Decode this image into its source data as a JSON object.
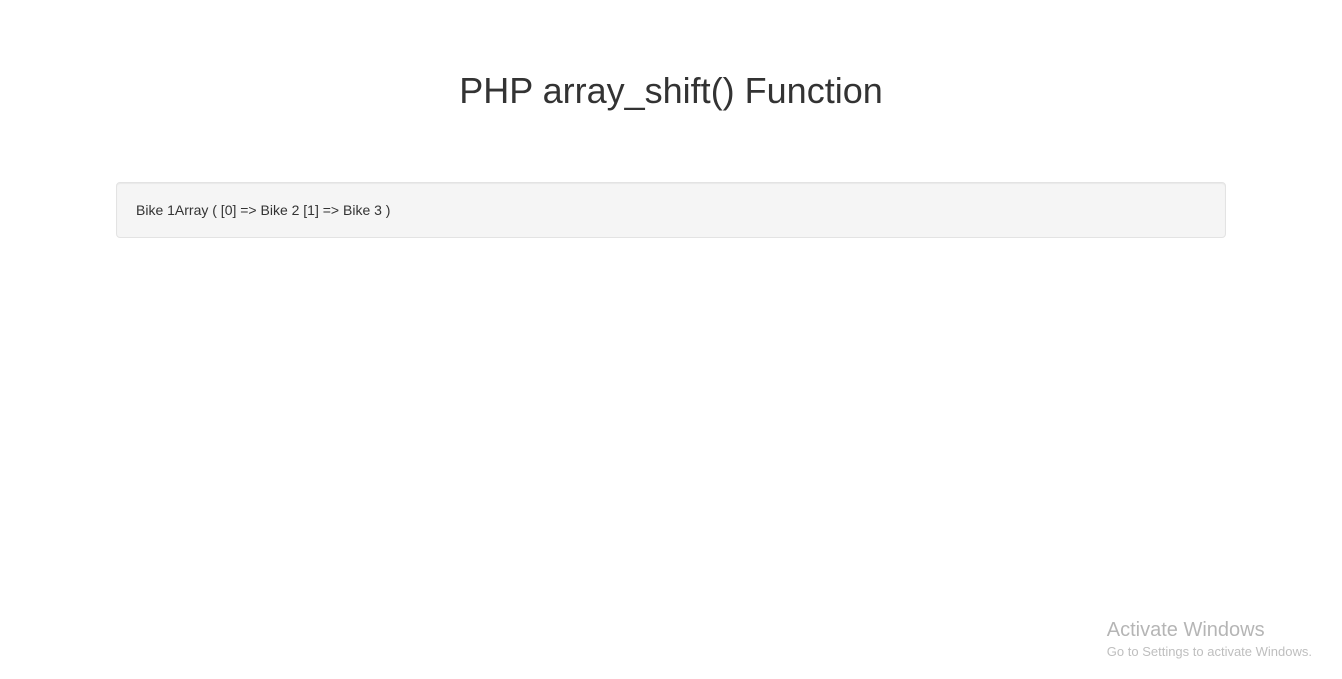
{
  "heading": "PHP array_shift() Function",
  "output": "Bike 1Array ( [0] => Bike 2 [1] => Bike 3 )",
  "watermark": {
    "title": "Activate Windows",
    "subtitle": "Go to Settings to activate Windows."
  }
}
